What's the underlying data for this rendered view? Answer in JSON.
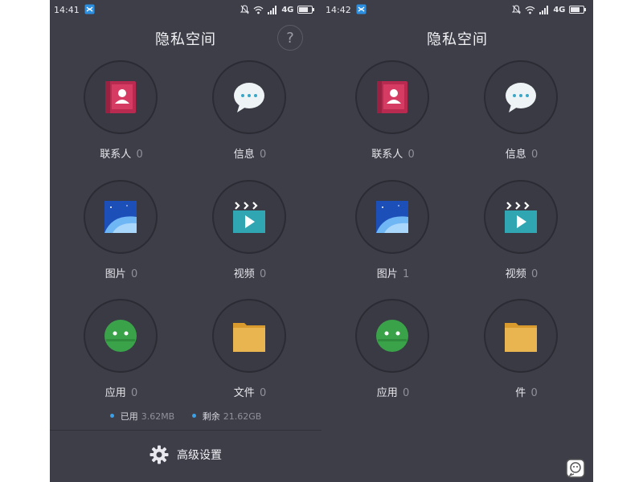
{
  "colors": {
    "background": "#3d3e48",
    "accent": "#3aa0e8",
    "contacts": "#c8345a",
    "pictures": "#1e59c4",
    "videos": "#2fa9b4",
    "apps": "#39a44a",
    "files": "#e6b24e"
  },
  "left": {
    "status": {
      "time": "14:41",
      "network": "4G"
    },
    "title": "隐私空间",
    "help": "?",
    "items": [
      {
        "label": "联系人",
        "count": "0",
        "icon": "contacts-book-icon"
      },
      {
        "label": "信息",
        "count": "0",
        "icon": "message-bubble-icon"
      },
      {
        "label": "图片",
        "count": "0",
        "icon": "picture-icon"
      },
      {
        "label": "视频",
        "count": "0",
        "icon": "video-icon"
      },
      {
        "label": "应用",
        "count": "0",
        "icon": "android-app-icon"
      },
      {
        "label": "文件",
        "count": "0",
        "icon": "folder-icon"
      }
    ],
    "storage": {
      "used_label": "已用",
      "used": "3.62MB",
      "free_label": "剩余",
      "free": "21.62GB"
    },
    "advanced": "高级设置"
  },
  "right": {
    "status": {
      "time": "14:42",
      "network": "4G"
    },
    "title": "隐私空间",
    "items": [
      {
        "label": "联系人",
        "count": "0",
        "icon": "contacts-book-icon"
      },
      {
        "label": "信息",
        "count": "0",
        "icon": "message-bubble-icon"
      },
      {
        "label": "图片",
        "count": "1",
        "icon": "picture-icon"
      },
      {
        "label": "视频",
        "count": "0",
        "icon": "video-icon"
      },
      {
        "label": "应用",
        "count": "0",
        "icon": "android-app-icon"
      },
      {
        "label": "件",
        "count": "0",
        "icon": "folder-icon"
      }
    ]
  }
}
